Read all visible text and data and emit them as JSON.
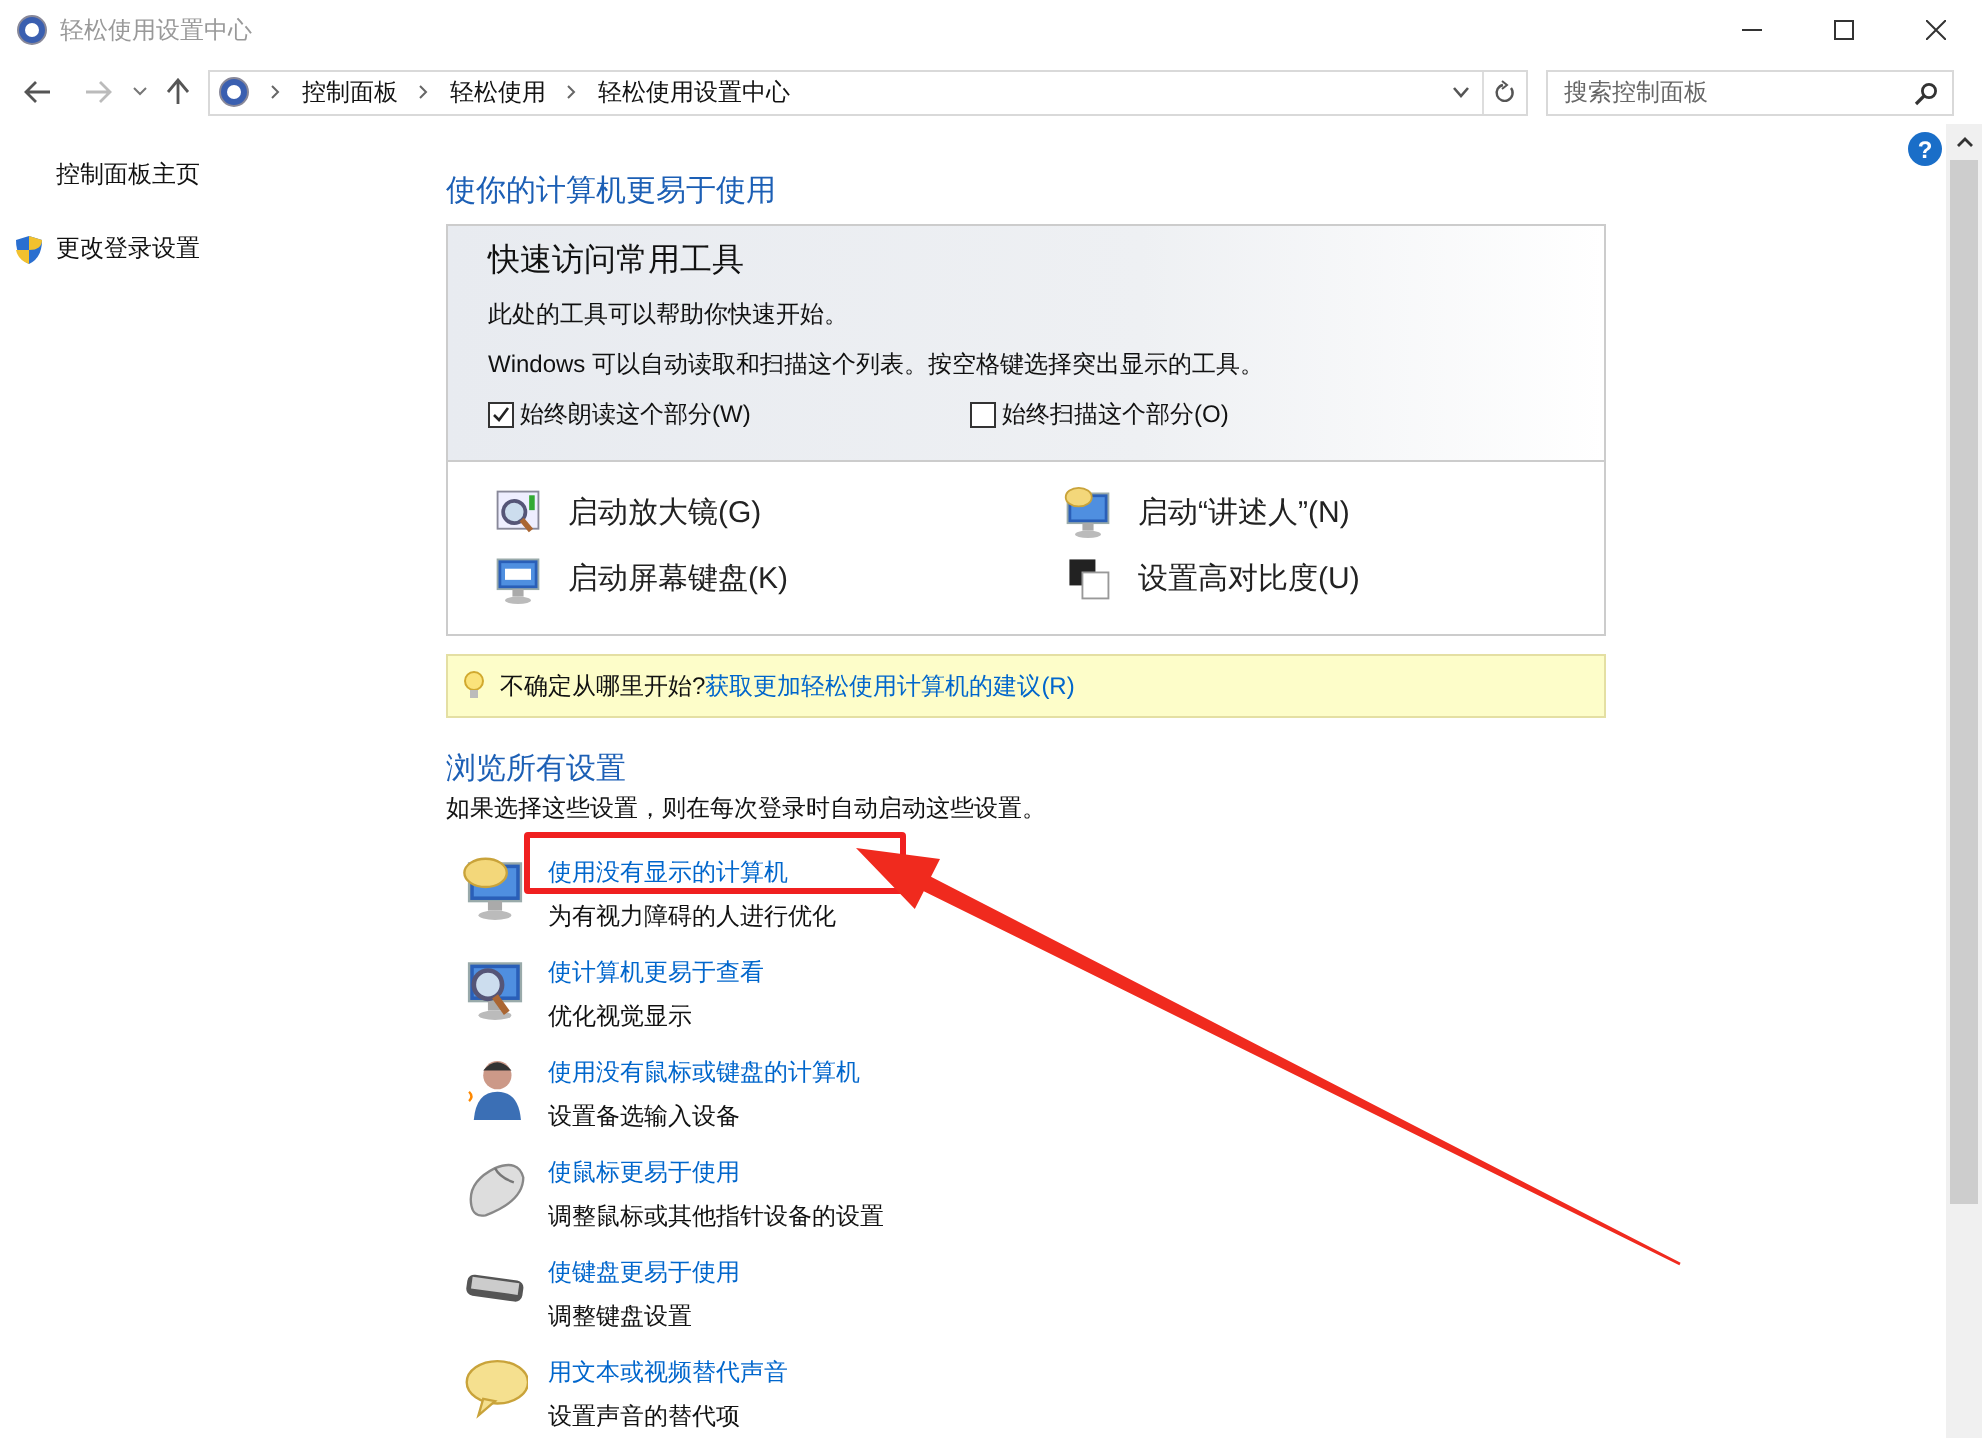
{
  "window": {
    "title": "轻松使用设置中心"
  },
  "address_bar": {
    "breadcrumbs": [
      "控制面板",
      "轻松使用",
      "轻松使用设置中心"
    ]
  },
  "search": {
    "placeholder": "搜索控制面板"
  },
  "sidebar": {
    "items": [
      {
        "label": "控制面板主页",
        "kind": "plain"
      },
      {
        "label": "更改登录设置",
        "kind": "shield"
      }
    ]
  },
  "heading": "使你的计算机更易于使用",
  "quick_access": {
    "title": "快速访问常用工具",
    "description": "此处的工具可以帮助你快速开始。",
    "hint": "Windows 可以自动读取和扫描这个列表。按空格键选择突出显示的工具。",
    "checkboxes": [
      {
        "label": "始终朗读这个部分(W)",
        "checked": true
      },
      {
        "label": "始终扫描这个部分(O)",
        "checked": false
      }
    ],
    "tools": [
      {
        "label": "启动放大镜(G)",
        "kind": "magnifier"
      },
      {
        "label": "启动“讲述人”(N)",
        "kind": "narrator"
      },
      {
        "label": "启动屏幕键盘(K)",
        "kind": "keyboard"
      },
      {
        "label": "设置高对比度(U)",
        "kind": "contrast"
      }
    ]
  },
  "tip": {
    "text": "不确定从哪里开始?",
    "link": "获取更加轻松使用计算机的建议(R)"
  },
  "browse": {
    "title": "浏览所有设置",
    "description": "如果选择这些设置，则在每次登录时自动启动这些设置。",
    "items": [
      {
        "title": "使用没有显示的计算机",
        "subtitle": "为有视力障碍的人进行优化",
        "kind": "display-off",
        "highlighted": true
      },
      {
        "title": "使计算机更易于查看",
        "subtitle": "优化视觉显示",
        "kind": "view",
        "highlighted": false
      },
      {
        "title": "使用没有鼠标或键盘的计算机",
        "subtitle": "设置备选输入设备",
        "kind": "person",
        "highlighted": false
      },
      {
        "title": "使鼠标更易于使用",
        "subtitle": "调整鼠标或其他指针设备的设置",
        "kind": "mouse",
        "highlighted": false
      },
      {
        "title": "使键盘更易于使用",
        "subtitle": "调整键盘设置",
        "kind": "keyboard",
        "highlighted": false
      },
      {
        "title": "用文本或视频替代声音",
        "subtitle": "设置声音的替代项",
        "kind": "speech",
        "highlighted": false
      }
    ]
  },
  "help": {
    "glyph": "?"
  },
  "annotation": {
    "arrow": true
  }
}
